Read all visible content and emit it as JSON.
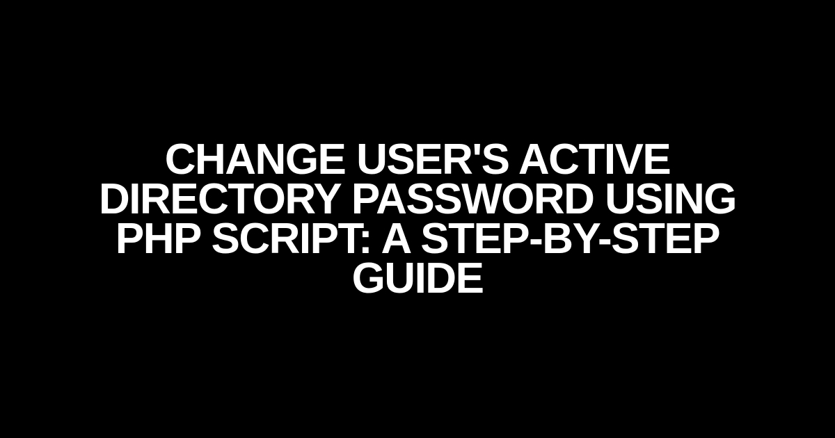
{
  "title": "CHANGE USER'S ACTIVE DIRECTORY PASSWORD USING PHP SCRIPT: A STEP-BY-STEP GUIDE"
}
